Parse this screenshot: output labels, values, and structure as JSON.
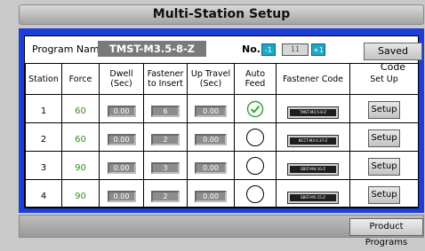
{
  "title": "Multi-Station Setup",
  "program": {
    "label": "Program Name",
    "name": "TMST-M3.5-8-Z",
    "no_label": "No.",
    "minus": "-1",
    "plus": "+1",
    "number": "11",
    "saved_code": "Saved Code"
  },
  "columns": [
    "Station",
    "Force",
    "Dwell (Sec)",
    "Fastener to Insert",
    "Up Travel (Sec)",
    "Auto Feed",
    "Fastener Code",
    "Set Up"
  ],
  "stations": [
    {
      "station": "1",
      "force": "60",
      "dwell": "0.00",
      "fastener": "6",
      "up_travel": "0.00",
      "auto_feed": true,
      "code": "TMST-M3.5-8-Z",
      "setup": "Setup"
    },
    {
      "station": "2",
      "force": "60",
      "dwell": "0.00",
      "fastener": "2",
      "up_travel": "0.00",
      "auto_feed": false,
      "code": "NCCT-M3-0.37-Z",
      "setup": "Setup"
    },
    {
      "station": "3",
      "force": "90",
      "dwell": "0.00",
      "fastener": "3",
      "up_travel": "0.00",
      "auto_feed": false,
      "code": "SBST-M4-10-Z",
      "setup": "Setup"
    },
    {
      "station": "4",
      "force": "90",
      "dwell": "0.00",
      "fastener": "2",
      "up_travel": "0.00",
      "auto_feed": false,
      "code": "SBST-M5-15-Z",
      "setup": "Setup"
    }
  ],
  "footer": {
    "product_programs": "Product Programs"
  },
  "colors": {
    "panel": "#1d3fd8",
    "force_text": "#3b8a1d",
    "check": "#33a333"
  }
}
